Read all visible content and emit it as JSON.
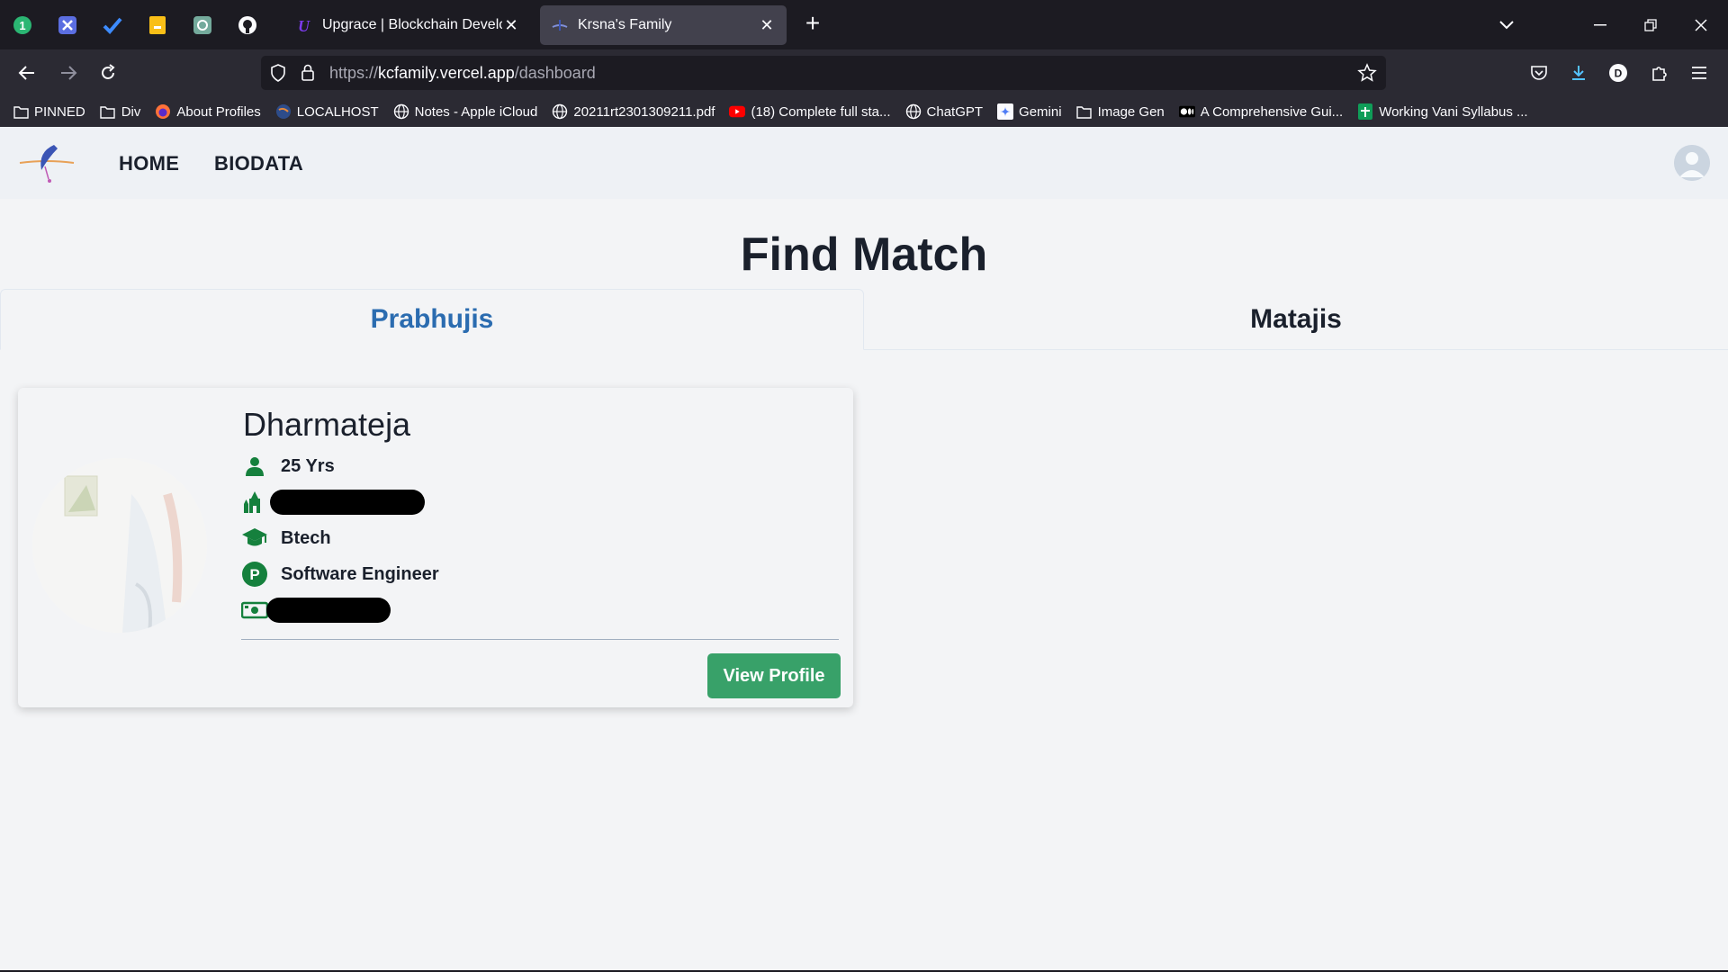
{
  "browser": {
    "tabs": [
      {
        "title": "Upgrace | Blockchain Develope",
        "active": false
      },
      {
        "title": "Krsna's Family",
        "active": true
      }
    ],
    "url": {
      "prefix": "https://",
      "domain": "kcfamily.vercel.app",
      "path": "/dashboard"
    },
    "bookmarks": [
      {
        "label": "PINNED",
        "icon": "folder-icon"
      },
      {
        "label": "Div",
        "icon": "folder-icon"
      },
      {
        "label": "About Profiles",
        "icon": "firefox-icon"
      },
      {
        "label": "LOCALHOST",
        "icon": "globe-dark-icon"
      },
      {
        "label": "Notes - Apple iCloud",
        "icon": "globe-icon"
      },
      {
        "label": "20211rt2301309211.pdf",
        "icon": "globe-icon"
      },
      {
        "label": "(18) Complete full sta...",
        "icon": "youtube-icon"
      },
      {
        "label": "ChatGPT",
        "icon": "globe-icon"
      },
      {
        "label": "Gemini",
        "icon": "gemini-icon"
      },
      {
        "label": "Image Gen",
        "icon": "folder-icon"
      },
      {
        "label": "A Comprehensive Gui...",
        "icon": "medium-icon"
      },
      {
        "label": "Working Vani Syllabus ...",
        "icon": "sheets-icon"
      }
    ],
    "colors": {
      "tabbar": "#1c1b22",
      "toolbar": "#2b2a33",
      "active_tab": "#42414d"
    }
  },
  "site": {
    "nav": {
      "home": "HOME",
      "biodata": "BIODATA"
    },
    "title": "Find Match",
    "tabs": {
      "prabhujis": "Prabhujis",
      "matajis": "Matajis",
      "selected": "Prabhujis"
    },
    "profile": {
      "name": "Dharmateja",
      "age": "25 Yrs",
      "education": "Btech",
      "profession": "Software Engineer",
      "view_button": "View Profile"
    },
    "colors": {
      "accent_blue": "#2b6cb0",
      "icon_green": "#15803d",
      "button_green": "#38a169"
    }
  }
}
